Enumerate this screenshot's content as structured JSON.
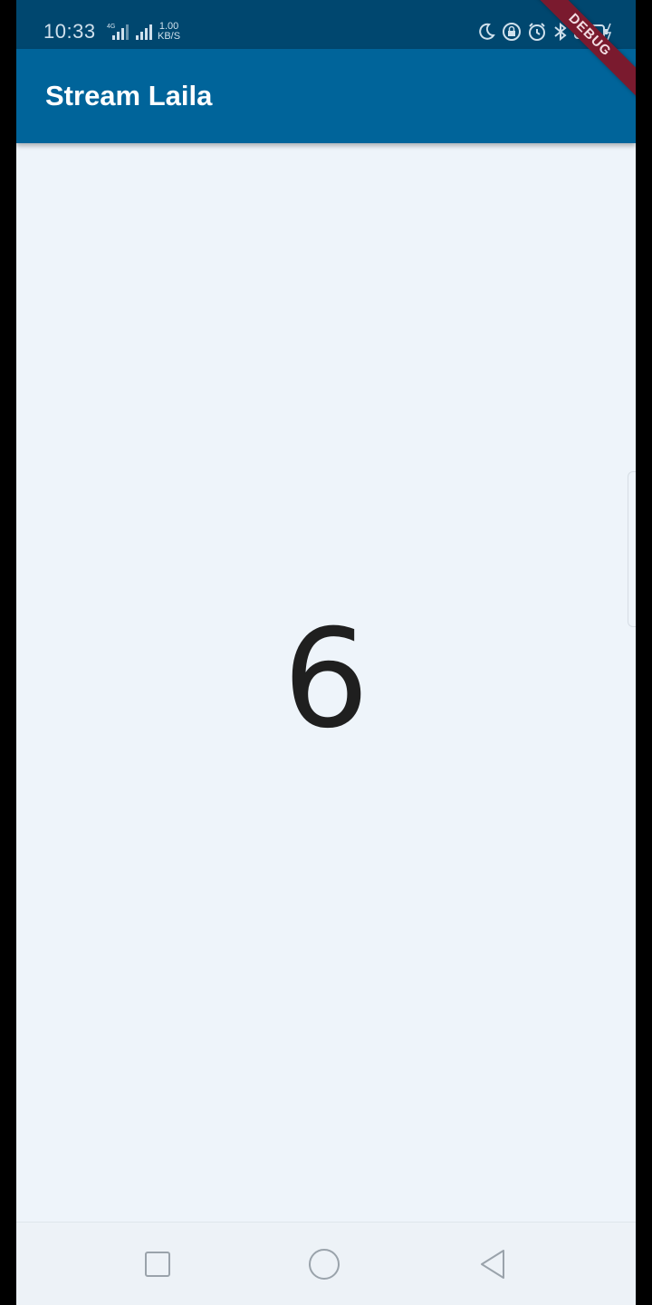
{
  "status_bar": {
    "time": "10:33",
    "network_type": "4G",
    "speed_value": "1.00",
    "speed_unit": "KB/S",
    "icons": [
      "moon-icon",
      "vpn-lock-icon",
      "alarm-icon",
      "bluetooth-icon",
      "battery-icon"
    ],
    "background": "#00476f"
  },
  "app_bar": {
    "title": "Stream Laila",
    "background": "#00649a"
  },
  "debug_banner": {
    "label": "DEBUG",
    "color": "#7a1a2e"
  },
  "main": {
    "counter_value": "6",
    "background": "#eef4fa"
  },
  "nav_bar": {
    "buttons": [
      "recents-button",
      "home-button",
      "back-button"
    ]
  }
}
